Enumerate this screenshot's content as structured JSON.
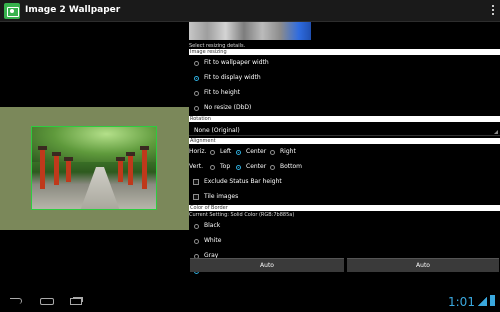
{
  "app": {
    "title": "Image 2 Wallpaper",
    "icon": "wallpaper-app-icon"
  },
  "settings": {
    "select_hint": "Select resizing details.",
    "image_resizing": {
      "header": "Image resizing",
      "options": [
        {
          "label": "Fit to wallpaper width",
          "selected": false
        },
        {
          "label": "Fit to display width",
          "selected": true
        },
        {
          "label": "Fit to height",
          "selected": false
        },
        {
          "label": "No resize (DbD)",
          "selected": false
        }
      ]
    },
    "rotation": {
      "header": "Rotation",
      "value": "None (Original)"
    },
    "alignment": {
      "header": "Alignment",
      "horiz_label": "Horiz.",
      "horiz_options": [
        {
          "label": "Left",
          "selected": false
        },
        {
          "label": "Center",
          "selected": true
        },
        {
          "label": "Right",
          "selected": false
        }
      ],
      "vert_label": "Vert.",
      "vert_options": [
        {
          "label": "Top",
          "selected": false
        },
        {
          "label": "Center",
          "selected": true
        },
        {
          "label": "Bottom",
          "selected": false
        }
      ]
    },
    "exclude_status_bar": {
      "label": "Exclude Status Bar height",
      "checked": false
    },
    "tile_images": {
      "label": "Tile images",
      "checked": false
    },
    "border_color": {
      "header": "Color of Border",
      "current": "Current Setting: Solid Color (RGB:7b885a)",
      "value": "#7b885a",
      "options": [
        {
          "label": "Black",
          "selected": false
        },
        {
          "label": "White",
          "selected": false
        },
        {
          "label": "Gray",
          "selected": false
        },
        {
          "label": "Custom",
          "selected": true
        }
      ]
    }
  },
  "buttons": {
    "left": "Auto",
    "right": "Auto"
  },
  "status": {
    "clock": "1:01"
  },
  "colors": {
    "accent": "#33b5e5",
    "preview_bg": "#7b885a"
  }
}
